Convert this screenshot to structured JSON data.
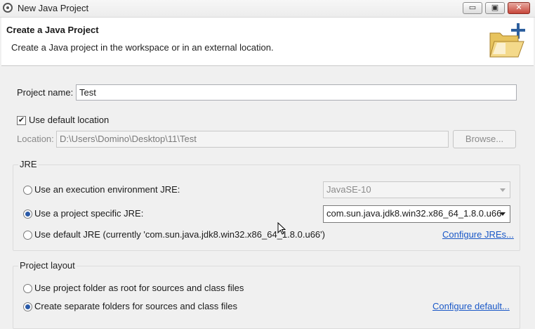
{
  "window": {
    "title": "New Java Project",
    "minimize": "▭",
    "maximize": "▣",
    "close": "✕"
  },
  "banner": {
    "title": "Create a Java Project",
    "description": "Create a Java project in the workspace or in an external location."
  },
  "project": {
    "name_label": "Project name:",
    "name_value": "Test",
    "use_default_location_label": "Use default location",
    "use_default_location_checked": true,
    "location_label": "Location:",
    "location_value": "D:\\Users\\Domino\\Desktop\\11\\Test",
    "browse_label": "Browse..."
  },
  "jre": {
    "group_title": "JRE",
    "option_env_label": "Use an execution environment JRE:",
    "option_env_value": "JavaSE-10",
    "option_specific_label": "Use a project specific JRE:",
    "option_specific_value": "com.sun.java.jdk8.win32.x86_64_1.8.0.u66",
    "option_default_label": "Use default JRE (currently 'com.sun.java.jdk8.win32.x86_64_1.8.0.u66')",
    "configure_link": "Configure JREs...",
    "selected": "specific"
  },
  "layout": {
    "group_title": "Project layout",
    "option_root_label": "Use project folder as root for sources and class files",
    "option_separate_label": "Create separate folders for sources and class files",
    "configure_link": "Configure default...",
    "selected": "separate"
  }
}
